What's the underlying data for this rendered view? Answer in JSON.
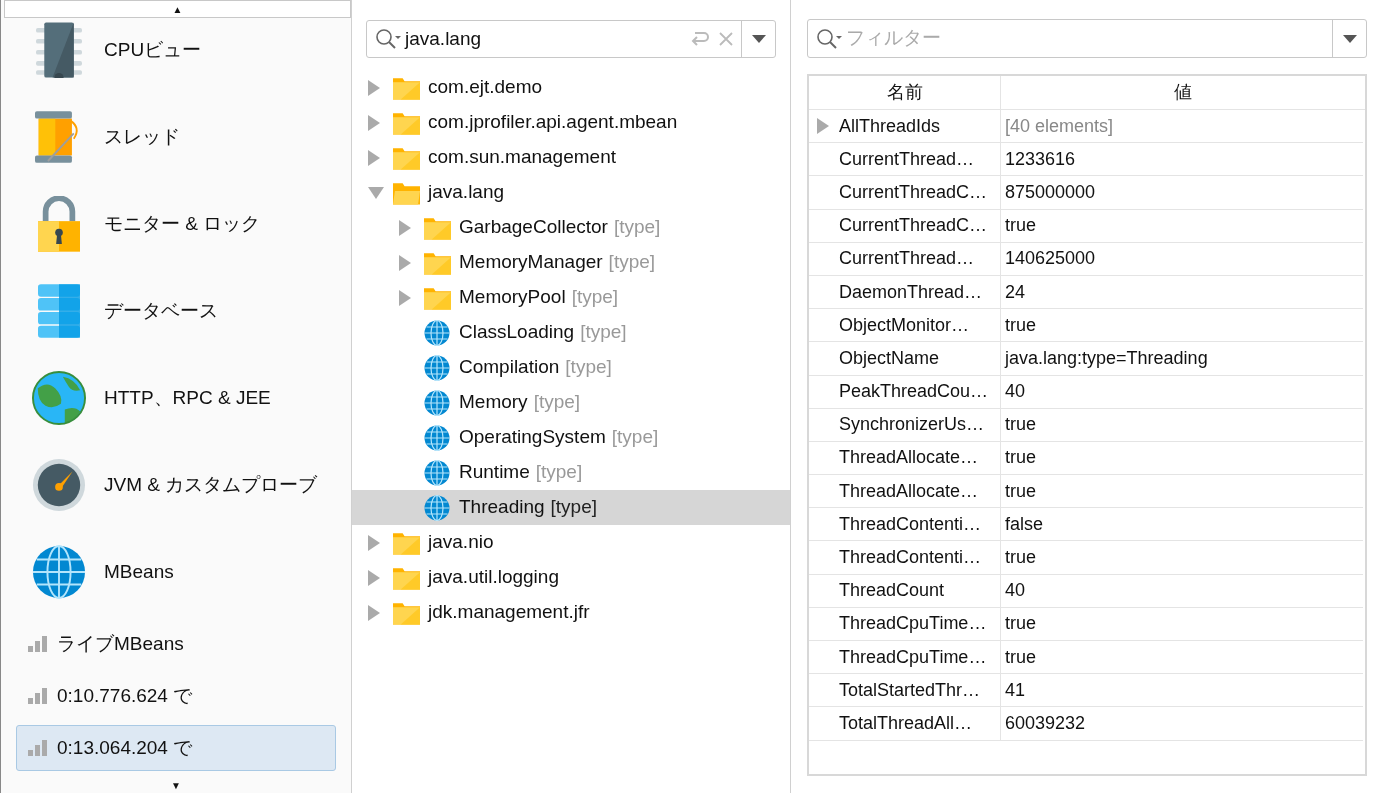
{
  "sidebar": {
    "scroll_up": "▲",
    "scroll_down": "▼",
    "views": [
      {
        "label": "CPUビュー"
      },
      {
        "label": "スレッド"
      },
      {
        "label": "モニター & ロック"
      },
      {
        "label": "データベース"
      },
      {
        "label": "HTTP、RPC & JEE"
      },
      {
        "label": "JVM & カスタムプローブ"
      },
      {
        "label": "MBeans"
      }
    ],
    "sessions": [
      {
        "label": "ライブMBeans",
        "selected": false
      },
      {
        "label": "0:10.776.624 で",
        "selected": false
      },
      {
        "label": "0:13.064.204 で",
        "selected": true
      }
    ]
  },
  "tree_panel": {
    "search": {
      "value": "java.lang"
    },
    "tree": [
      {
        "label": "com.ejt.demo",
        "kind": "folder",
        "expanded": false,
        "selected": false
      },
      {
        "label": "com.jprofiler.api.agent.mbean",
        "kind": "folder",
        "expanded": false,
        "selected": false
      },
      {
        "label": "com.sun.management",
        "kind": "folder",
        "expanded": false,
        "selected": false
      },
      {
        "label": "java.lang",
        "kind": "folder",
        "expanded": true,
        "selected": false,
        "children": [
          {
            "label": "GarbageCollector",
            "tag": "[type]",
            "kind": "folder",
            "expanded": false,
            "selected": false
          },
          {
            "label": "MemoryManager",
            "tag": "[type]",
            "kind": "folder",
            "expanded": false,
            "selected": false
          },
          {
            "label": "MemoryPool",
            "tag": "[type]",
            "kind": "folder",
            "expanded": false,
            "selected": false
          },
          {
            "label": "ClassLoading",
            "tag": "[type]",
            "kind": "bean",
            "selected": false
          },
          {
            "label": "Compilation",
            "tag": "[type]",
            "kind": "bean",
            "selected": false
          },
          {
            "label": "Memory",
            "tag": "[type]",
            "kind": "bean",
            "selected": false
          },
          {
            "label": "OperatingSystem",
            "tag": "[type]",
            "kind": "bean",
            "selected": false
          },
          {
            "label": "Runtime",
            "tag": "[type]",
            "kind": "bean",
            "selected": false
          },
          {
            "label": "Threading",
            "tag": "[type]",
            "kind": "bean",
            "selected": true
          }
        ]
      },
      {
        "label": "java.nio",
        "kind": "folder",
        "expanded": false,
        "selected": false
      },
      {
        "label": "java.util.logging",
        "kind": "folder",
        "expanded": false,
        "selected": false
      },
      {
        "label": "jdk.management.jfr",
        "kind": "folder",
        "expanded": false,
        "selected": false
      }
    ]
  },
  "attributes_panel": {
    "filter": {
      "placeholder": "フィルター"
    },
    "table": {
      "columns": [
        "名前",
        "値"
      ],
      "rows": [
        {
          "kind": "array",
          "name": "AllThreadIds",
          "value": "[40 elements]"
        },
        {
          "kind": "value",
          "name": "CurrentThread…",
          "value": "1233616"
        },
        {
          "kind": "value",
          "name": "CurrentThreadC…",
          "value": "875000000"
        },
        {
          "kind": "value",
          "name": "CurrentThreadC…",
          "value": "true"
        },
        {
          "kind": "value",
          "name": "CurrentThread…",
          "value": "140625000"
        },
        {
          "kind": "value",
          "name": "DaemonThread…",
          "value": "24"
        },
        {
          "kind": "value",
          "name": "ObjectMonitor…",
          "value": "true"
        },
        {
          "kind": "value",
          "name": "ObjectName",
          "value": "java.lang:type=Threading"
        },
        {
          "kind": "value",
          "name": "PeakThreadCou…",
          "value": "40"
        },
        {
          "kind": "value",
          "name": "SynchronizerUs…",
          "value": "true"
        },
        {
          "kind": "value",
          "name": "ThreadAllocate…",
          "value": "true"
        },
        {
          "kind": "value",
          "name": "ThreadAllocate…",
          "value": "true"
        },
        {
          "kind": "value",
          "name": "ThreadContenti…",
          "value": "false"
        },
        {
          "kind": "value",
          "name": "ThreadContenti…",
          "value": "true"
        },
        {
          "kind": "value",
          "name": "ThreadCount",
          "value": "40"
        },
        {
          "kind": "value",
          "name": "ThreadCpuTime…",
          "value": "true"
        },
        {
          "kind": "value",
          "name": "ThreadCpuTime…",
          "value": "true"
        },
        {
          "kind": "value",
          "name": "TotalStartedThr…",
          "value": "41"
        },
        {
          "kind": "value",
          "name": "TotalThreadAll…",
          "value": "60039232"
        }
      ]
    }
  }
}
